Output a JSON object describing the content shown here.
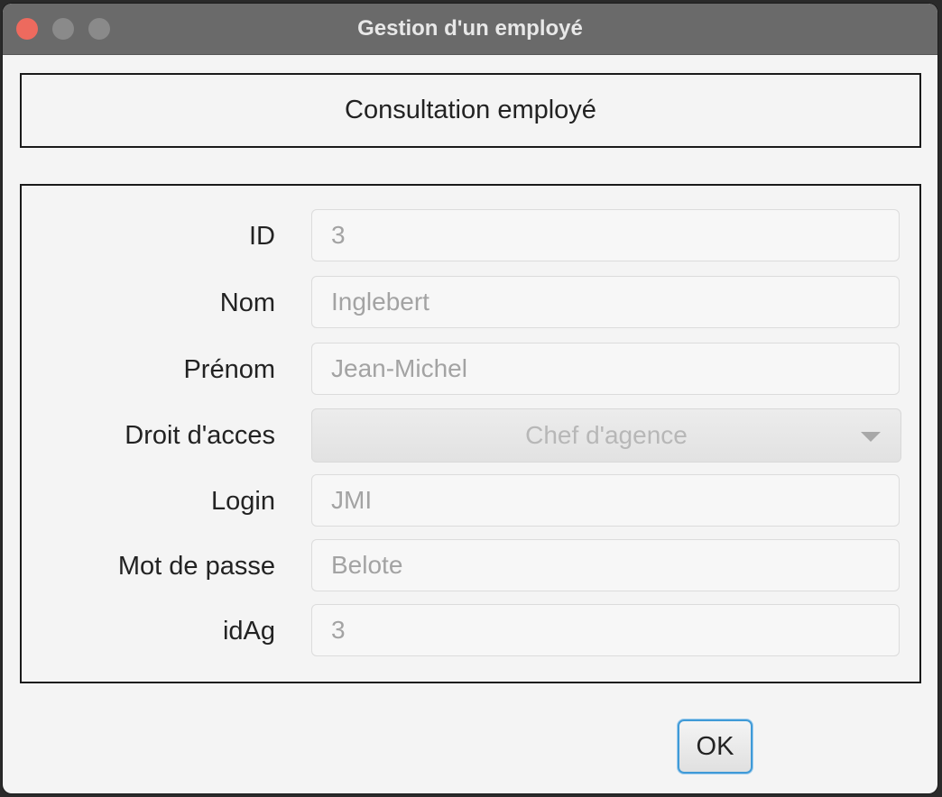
{
  "window": {
    "title": "Gestion d'un employé"
  },
  "header": {
    "title": "Consultation employé"
  },
  "form": {
    "fields": [
      {
        "label": "ID",
        "value": "3"
      },
      {
        "label": "Nom",
        "value": "Inglebert"
      },
      {
        "label": "Prénom",
        "value": "Jean-Michel"
      },
      {
        "label": "Droit d'acces",
        "value": "Chef d'agence"
      },
      {
        "label": "Login",
        "value": "JMI"
      },
      {
        "label": "Mot de passe",
        "value": "Belote"
      },
      {
        "label": "idAg",
        "value": "3"
      }
    ]
  },
  "actions": {
    "ok_label": "OK"
  },
  "colors": {
    "titlebar": "#6a6a6a",
    "close": "#ed6a5e",
    "focus_ring": "#3f9ad7",
    "disabled_text": "#a3a3a3"
  },
  "icons": [
    "close-dot-icon",
    "minimize-dot-icon",
    "zoom-dot-icon",
    "dropdown-caret-icon"
  ]
}
